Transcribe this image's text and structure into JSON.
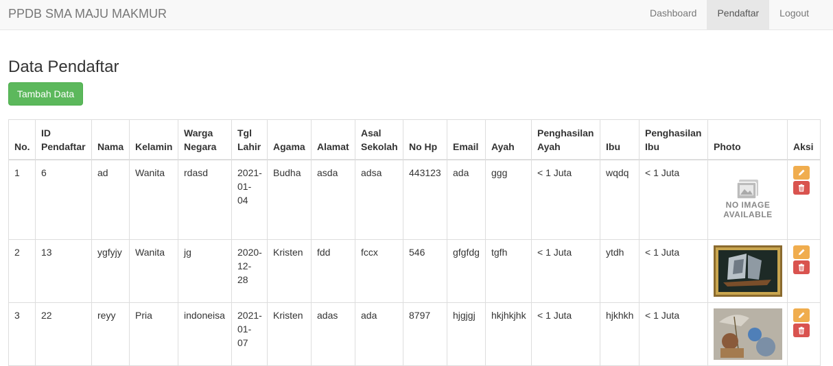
{
  "nav": {
    "brand": "PPDB SMA MAJU MAKMUR",
    "items": [
      {
        "label": "Dashboard"
      },
      {
        "label": "Pendaftar"
      },
      {
        "label": "Logout"
      }
    ]
  },
  "page": {
    "title": "Data Pendaftar",
    "add_button": "Tambah Data"
  },
  "table": {
    "headers": [
      "No.",
      "ID Pendaftar",
      "Nama",
      "Kelamin",
      "Warga Negara",
      "Tgl Lahir",
      "Agama",
      "Alamat",
      "Asal Sekolah",
      "No Hp",
      "Email",
      "Ayah",
      "Penghasilan Ayah",
      "Ibu",
      "Penghasilan Ibu",
      "Photo",
      "Aksi"
    ],
    "rows": [
      [
        "1",
        "6",
        "ad",
        "Wanita",
        "rdasd",
        "2021-01-04",
        "Budha",
        "asda",
        "adsa",
        "443123",
        "ada",
        "ggg",
        "< 1 Juta",
        "wqdq",
        "< 1 Juta"
      ],
      [
        "2",
        "13",
        "ygfyjy",
        "Wanita",
        "jg",
        "2020-12-28",
        "Kristen",
        "fdd",
        "fccx",
        "546",
        "gfgfdg",
        "tgfh",
        "< 1 Juta",
        "ytdh",
        "< 1 Juta"
      ],
      [
        "3",
        "22",
        "reyy",
        "Pria",
        "indoneisa",
        "2021-01-07",
        "Kristen",
        "adas",
        "ada",
        "8797",
        "hjgjgj",
        "hkjhkjhk",
        "< 1 Juta",
        "hjkhkh",
        "< 1 Juta"
      ]
    ],
    "no_image_text": "NO IMAGE AVAILABLE"
  },
  "icons": {
    "edit": "pencil-icon",
    "delete": "trash-icon",
    "no_image": "image-placeholder-icon"
  },
  "colors": {
    "success": "#5cb85c",
    "warning": "#f0ad4e",
    "danger": "#d9534f",
    "navbar_bg": "#f8f8f8"
  }
}
